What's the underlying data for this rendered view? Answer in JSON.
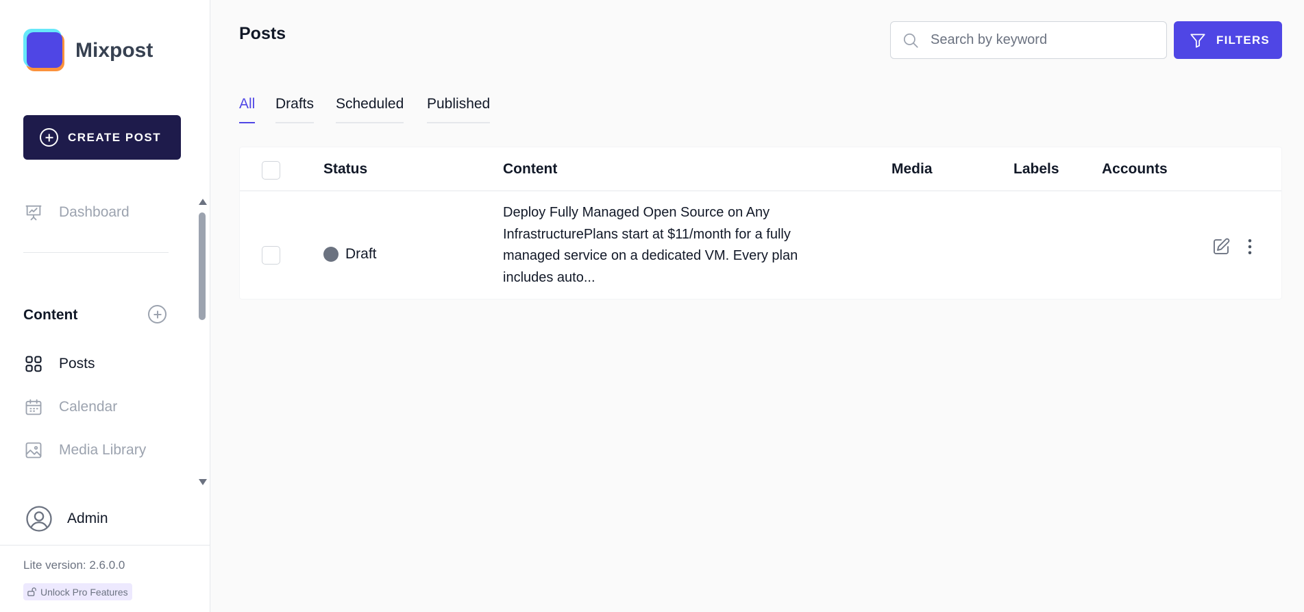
{
  "app": {
    "name": "Mixpost"
  },
  "sidebar": {
    "create_label": "CREATE POST",
    "dashboard_label": "Dashboard",
    "section_title": "Content",
    "items": [
      {
        "label": "Posts",
        "icon": "grid-icon",
        "active": true
      },
      {
        "label": "Calendar",
        "icon": "calendar-icon",
        "active": false
      },
      {
        "label": "Media Library",
        "icon": "image-icon",
        "active": false
      }
    ],
    "user_label": "Admin",
    "version_text": "Lite version: 2.6.0.0",
    "unlock_label": "Unlock Pro Features"
  },
  "page": {
    "title": "Posts"
  },
  "search": {
    "placeholder": "Search by keyword",
    "value": ""
  },
  "filters": {
    "label": "FILTERS"
  },
  "tabs": [
    {
      "label": "All",
      "active": true
    },
    {
      "label": "Drafts",
      "active": false
    },
    {
      "label": "Scheduled",
      "active": false
    },
    {
      "label": "Published",
      "active": false
    }
  ],
  "table": {
    "columns": [
      "Status",
      "Content",
      "Media",
      "Labels",
      "Accounts"
    ],
    "rows": [
      {
        "status": "Draft",
        "content": "Deploy Fully Managed Open Source on Any InfrastructurePlans start at $11/month for a fully managed service on a dedicated VM. Every plan includes auto..."
      }
    ]
  },
  "colors": {
    "brand": "#4f46e5",
    "create_button": "#1e1b4b",
    "draft_status": "#6b7280"
  }
}
